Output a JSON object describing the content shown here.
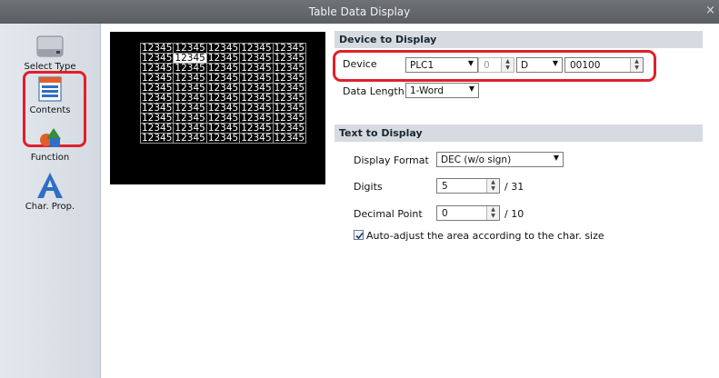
{
  "window": {
    "title": "Table Data Display",
    "close_glyph": "×"
  },
  "sidebar": {
    "items": [
      {
        "label": "Select Type",
        "icon": "drive-icon"
      },
      {
        "label": "Contents",
        "icon": "contents-icon",
        "selected": true
      },
      {
        "label": "Function",
        "icon": "shapes-icon"
      },
      {
        "label": "Char. Prop.",
        "icon": "letter-a-icon"
      }
    ]
  },
  "preview": {
    "rows": [
      [
        "12345",
        "12345",
        "12345",
        "12345",
        "12345"
      ],
      [
        "12345",
        "12345",
        "12345",
        "12345",
        "12345"
      ],
      [
        "12345",
        "12345",
        "12345",
        "12345",
        "12345"
      ],
      [
        "12345",
        "12345",
        "12345",
        "12345",
        "12345"
      ],
      [
        "12345",
        "12345",
        "12345",
        "12345",
        "12345"
      ],
      [
        "12345",
        "12345",
        "12345",
        "12345",
        "12345"
      ],
      [
        "12345",
        "12345",
        "12345",
        "12345",
        "12345"
      ],
      [
        "12345",
        "12345",
        "12345",
        "12345",
        "12345"
      ],
      [
        "12345",
        "12345",
        "12345",
        "12345",
        "12345"
      ],
      [
        "12345",
        "12345",
        "12345",
        "12345",
        "12345"
      ]
    ]
  },
  "device_to_display": {
    "heading": "Device to Display",
    "device_label": "Device",
    "device_plc": "PLC1",
    "device_station": "0",
    "device_type": "D",
    "device_address": "00100",
    "data_length_label": "Data Length",
    "data_length": "1-Word"
  },
  "text_to_display": {
    "heading": "Text to Display",
    "display_format_label": "Display Format",
    "display_format": "DEC (w/o sign)",
    "digits_label": "Digits",
    "digits": "5",
    "digits_max": "/ 31",
    "decimal_point_label": "Decimal Point",
    "decimal_point": "0",
    "decimal_point_max": "/ 10",
    "auto_adjust_label": "Auto-adjust the area according to the char. size",
    "auto_adjust_checked": true
  },
  "colors": {
    "highlight": "#e0202a",
    "section_bg": "#d6dbe2",
    "titlebar": "#63666a"
  }
}
